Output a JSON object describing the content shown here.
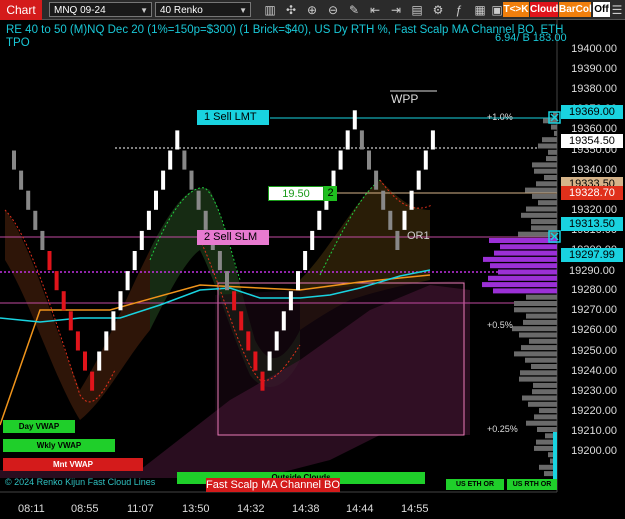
{
  "toolbar": {
    "title": "Chart",
    "instrument": "MNQ 09-24",
    "period": "40 Renko",
    "btn_tk": "T<>K",
    "btn_cloud": "Cloud",
    "btn_barcol": "BarCol",
    "btn_off": "Off",
    "colors": {
      "tk": "#f07f0d",
      "cloud": "#e0141b",
      "barcol": "#f07f0d",
      "off": "#ffffff"
    },
    "icons": [
      "bars-icon",
      "crosshair-icon",
      "zoom-in-icon",
      "zoom-out-icon",
      "pencil-icon",
      "scroll-left-icon",
      "scroll-right-icon",
      "properties-icon",
      "strategy-icon",
      "indicator-icon",
      "template-icon",
      "data-box-icon",
      "list-icon"
    ]
  },
  "header": {
    "line1": "RE 40 to 50 (M)NQ Dec 20 (1%=150p=$300) (1 Brick=$40), US Dy RTH %, Fast Scalp MA Channel BO, ETH",
    "line2": "TPO",
    "badge": "6.94/ B 183.00"
  },
  "chart_data": {
    "type": "renko",
    "y_axis_prices": [
      "19400.00",
      "19390.00",
      "19380.00",
      "19370.00",
      "19360.00",
      "19350.00",
      "19340.00",
      "19330.00",
      "19320.00",
      "19310.00",
      "19300.00",
      "19290.00",
      "19280.00",
      "19270.00",
      "19260.00",
      "19250.00",
      "19240.00",
      "19230.00",
      "19220.00",
      "19210.00",
      "19200.00"
    ],
    "x_axis_times": [
      "08:11",
      "08:55",
      "11:07",
      "13:50",
      "14:32",
      "14:38",
      "14:44",
      "14:55"
    ],
    "price_tags": [
      {
        "value": "19369.00",
        "color": "#19d3e0"
      },
      {
        "value": "19354.50",
        "color": "#ffffff"
      },
      {
        "value": "19333.50",
        "color": "#d6b48a"
      },
      {
        "value": "19328.70",
        "color": "#e0301b"
      },
      {
        "value": "19313.50",
        "color": "#19d3e0"
      },
      {
        "value": "19297.99",
        "color": "#19d3e0"
      },
      {
        "value": "19290.00",
        "color": "#000000"
      }
    ],
    "annotations": {
      "wpp": "WPP",
      "or1": "OR1",
      "pct_1": "+1.0%",
      "pct_05": "+0.5%",
      "pct_025": "+0.25%"
    }
  },
  "orders": {
    "sell_lmt": "1  Sell LMT",
    "sell_slm": "2  Sell SLM",
    "price_box": "19.50",
    "qty_box": "2"
  },
  "overlays": {
    "day_vwap": "Day VWAP",
    "wkly_vwap": "Wkly VWAP",
    "mnt_vwap": "Mnt VWAP",
    "outside_clouds": "Outside Clouds",
    "kijun": "© 2024 Renko Kijun Fast Cloud Lines",
    "fast_scalp": "Fast Scalp MA Channel BO",
    "us_eth_or": "US ETH OR",
    "us_rth_or": "US RTH OR"
  }
}
